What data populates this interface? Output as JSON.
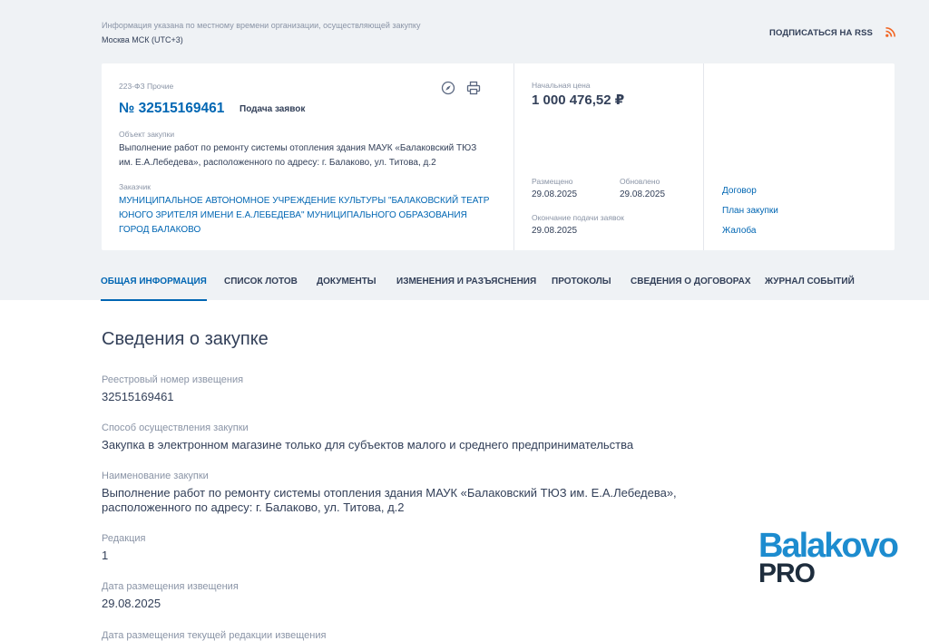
{
  "header": {
    "tz_note": "Информация указана по местному времени организации, осуществляющей закупку",
    "tz_zone": "Москва МСК (UTC+3)",
    "rss_label": "ПОДПИСАТЬСЯ НА RSS"
  },
  "card": {
    "law_type": "223-ФЗ Прочие",
    "number": "№ 32515169461",
    "stage": "Подача заявок",
    "object_label": "Объект закупки",
    "object_line1": "Выполнение работ по ремонту системы отопления здания МАУК «Балаковский ТЮЗ",
    "object_line2": "им. Е.А.Лебедева», расположенного по адресу: г. Балаково, ул. Титова, д.2",
    "customer_label": "Заказчик",
    "customer_line1": "МУНИЦИПАЛЬНОЕ АВТОНОМНОЕ УЧРЕЖДЕНИЕ КУЛЬТУРЫ \"БАЛАКОВСКИЙ ТЕАТР",
    "customer_line2": "ЮНОГО ЗРИТЕЛЯ ИМЕНИ Е.А.ЛЕБЕДЕВА\" МУНИЦИПАЛЬНОГО ОБРАЗОВАНИЯ",
    "customer_line3": "ГОРОД БАЛАКОВО",
    "price_label": "Начальная цена",
    "price": "1 000 476,52 ₽",
    "placed_label": "Размещено",
    "placed": "29.08.2025",
    "updated_label": "Обновлено",
    "updated": "29.08.2025",
    "deadline_label": "Окончание подачи заявок",
    "deadline": "29.08.2025",
    "links": [
      "Договор",
      "План закупки",
      "Жалоба"
    ]
  },
  "tabs": [
    "ОБЩАЯ ИНФОРМАЦИЯ",
    "СПИСОК ЛОТОВ",
    "ДОКУМЕНТЫ",
    "ИЗМЕНЕНИЯ И РАЗЪЯСНЕНИЯ",
    "ПРОТОКОЛЫ",
    "СВЕДЕНИЯ О ДОГОВОРАХ",
    "ЖУРНАЛ СОБЫТИЙ"
  ],
  "section": {
    "title": "Сведения о закупке",
    "fields": [
      {
        "label": "Реестровый номер извещения",
        "value": "32515169461"
      },
      {
        "label": "Способ осуществления закупки",
        "value": "Закупка в электронном магазине только для субъектов малого и среднего предпринимательства"
      },
      {
        "label": "Наименование закупки",
        "value": "Выполнение работ по ремонту системы отопления здания МАУК «Балаковский ТЮЗ им. Е.А.Лебедева»,",
        "value2": "расположенного по адресу: г. Балаково, ул. Титова, д.2"
      },
      {
        "label": "Редакция",
        "value": "1"
      },
      {
        "label": "Дата размещения извещения",
        "value": "29.08.2025"
      }
    ],
    "cut_label": "Дата размещения текущей редакции извещения"
  },
  "watermark": {
    "top": "Balakovo",
    "bottom": "PRO"
  },
  "colors": {
    "accent": "#0066b3",
    "background": "#eff2f5",
    "rss": "#f26522"
  }
}
